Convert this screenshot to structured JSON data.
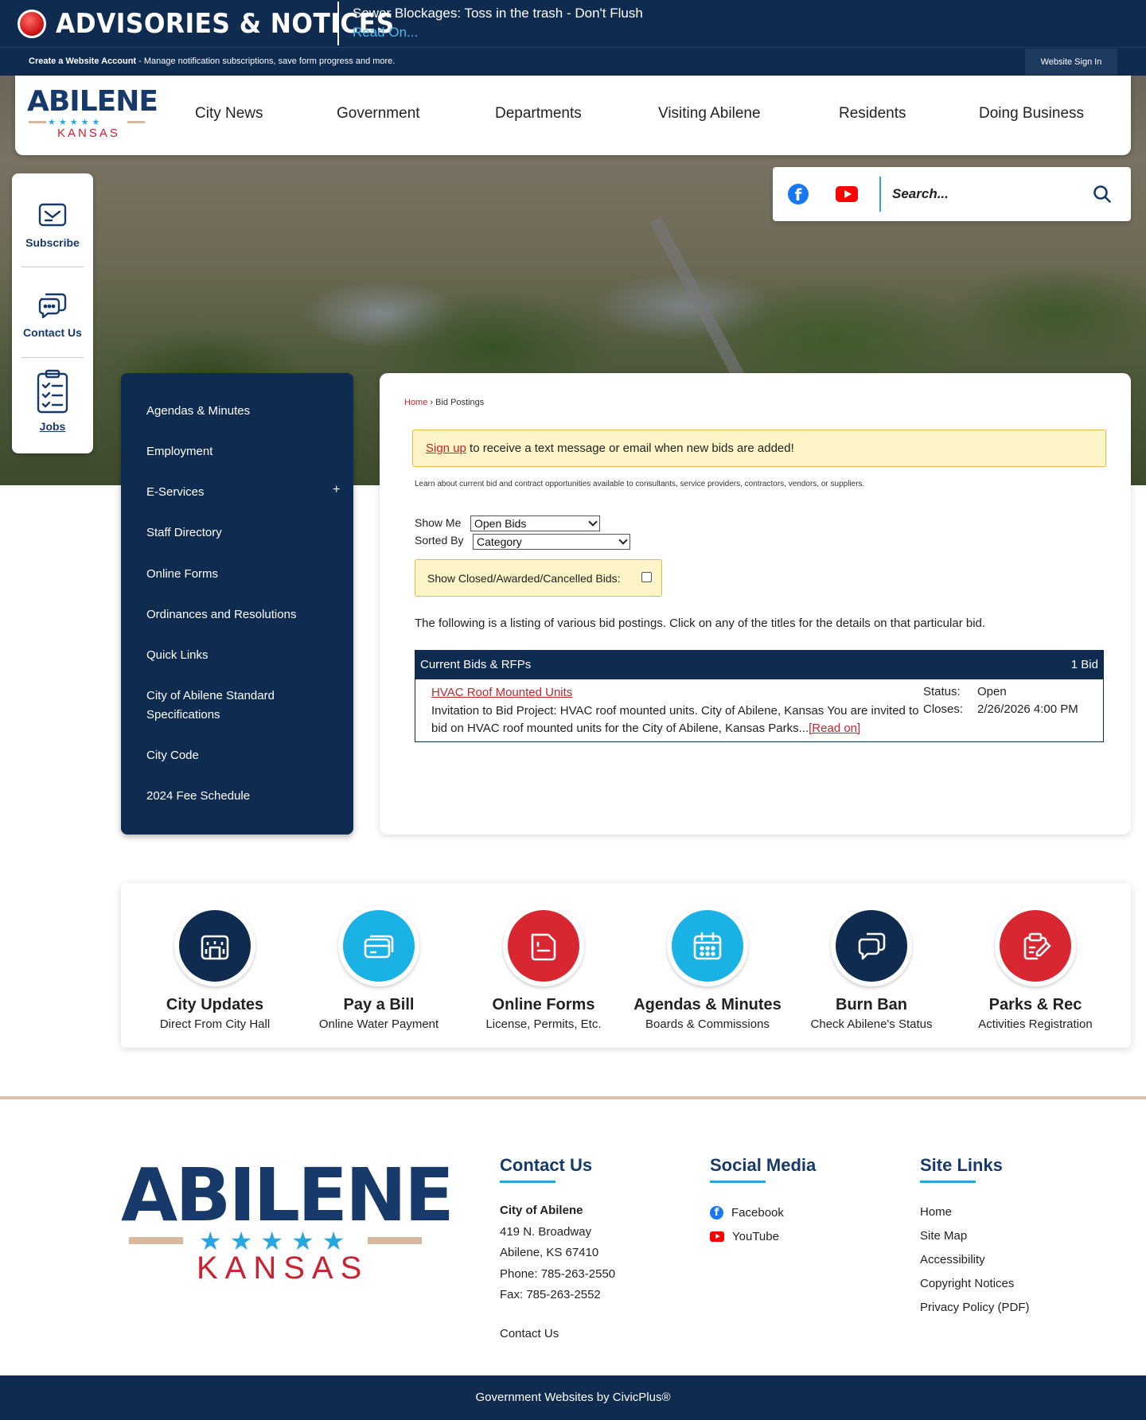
{
  "advisory": {
    "title": "ADVISORIES & NOTICES",
    "message": "Sewer Blockages: Toss in the trash - Don't Flush",
    "link": "Read On..."
  },
  "account_bar": {
    "create_label": "Create a Website Account",
    "create_desc": " - Manage notification subscriptions, save form progress and more.",
    "signin_label": "Website Sign In"
  },
  "logo": {
    "name": "ABILENE",
    "state": "KANSAS",
    "stars": "★★★★★"
  },
  "nav": {
    "items": [
      "City News",
      "Government",
      "Departments",
      "Visiting Abilene",
      "Residents",
      "Doing Business"
    ]
  },
  "quick_bar": {
    "items": [
      {
        "label": "Subscribe",
        "icon": "envelope-icon"
      },
      {
        "label": "Contact Us",
        "icon": "chat-icon"
      },
      {
        "label": "Jobs",
        "icon": "checklist-icon"
      }
    ]
  },
  "search": {
    "placeholder": "Search..."
  },
  "side_menu": {
    "items": [
      "Agendas & Minutes",
      "Employment",
      "E-Services",
      "Staff Directory",
      "Online Forms",
      "Ordinances and Resolutions",
      "Quick Links",
      "City of Abilene Standard Specifications",
      "City Code",
      "2024 Fee Schedule"
    ],
    "expand_symbol": "+"
  },
  "content": {
    "breadcrumb": {
      "home": "Home",
      "separator": "›",
      "current": "Bid Postings"
    },
    "signup": {
      "link": "Sign up",
      "text": " to receive a text message or email when new bids are added!"
    },
    "learn_text": "Learn about current bid and contract opportunities available to consultants, service providers, contractors, vendors, or suppliers.",
    "show_me": {
      "label": "Show Me",
      "value": "Open Bids"
    },
    "sorted_by": {
      "label": "Sorted By",
      "value": "Category"
    },
    "closed_label": "Show Closed/Awarded/Cancelled Bids:",
    "listing_text": "The following is a listing of various bid postings. Click on any of the titles for the details on that particular bid.",
    "table": {
      "title": "Current Bids & RFPs",
      "count": "1 Bid",
      "bid": {
        "title": "HVAC Roof Mounted Units",
        "description": "Invitation to Bid Project: HVAC roof mounted units. City of Abilene, Kansas You are invited to bid on HVAC roof mounted units for the City of Abilene, Kansas Parks...",
        "read_on": "[Read on]",
        "status_label": "Status:",
        "status_value": "Open",
        "closes_label": "Closes:",
        "closes_value": "2/26/2026 4:00 PM"
      }
    }
  },
  "quick_links": [
    {
      "title": "City Updates",
      "sub": "Direct From City Hall",
      "color": "#0f2b4f",
      "icon": "building-icon"
    },
    {
      "title": "Pay a Bill",
      "sub": "Online Water Payment",
      "color": "#1ab1e4",
      "icon": "credit-card-icon"
    },
    {
      "title": "Online Forms",
      "sub": "License, Permits, Etc.",
      "color": "#d92732",
      "icon": "form-icon"
    },
    {
      "title": "Agendas & Minutes",
      "sub": "Boards & Commissions",
      "color": "#1ab1e4",
      "icon": "calendar-icon"
    },
    {
      "title": "Burn Ban",
      "sub": "Check Abilene's Status",
      "color": "#0f2b4f",
      "icon": "chat-bubbles-icon"
    },
    {
      "title": "Parks & Rec",
      "sub": "Activities Registration",
      "color": "#d92732",
      "icon": "clipboard-edit-icon"
    }
  ],
  "footer": {
    "contact": {
      "heading": "Contact Us",
      "org": "City of Abilene",
      "address1": "419 N. Broadway",
      "address2": "Abilene, KS 67410",
      "phone": "Phone: 785-263-2550",
      "fax": "Fax: 785-263-2552",
      "link": "Contact Us"
    },
    "social": {
      "heading": "Social Media",
      "facebook": "Facebook",
      "youtube": "YouTube"
    },
    "site_links": {
      "heading": "Site Links",
      "items": [
        "Home",
        "Site Map",
        "Accessibility",
        "Copyright Notices",
        "Privacy Policy (PDF)"
      ]
    }
  },
  "bottom_bar": "Government Websites by CivicPlus®"
}
